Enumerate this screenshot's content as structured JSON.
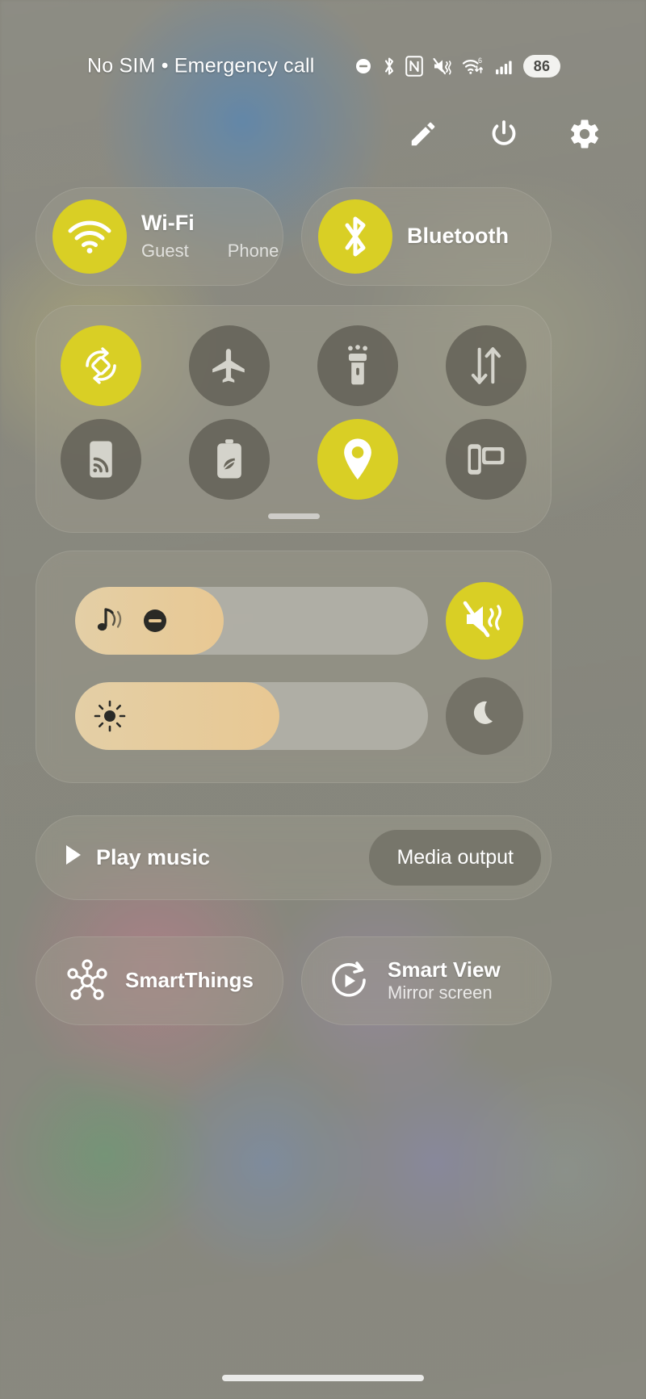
{
  "status_bar": {
    "carrier_text": "No SIM • Emergency call",
    "icons": [
      {
        "name": "do-not-disturb-icon",
        "label": "Do not disturb"
      },
      {
        "name": "bluetooth-icon",
        "label": "Bluetooth"
      },
      {
        "name": "nfc-icon",
        "label": "NFC"
      },
      {
        "name": "sound-vibrate-off-icon",
        "label": "Mute / vibrate"
      },
      {
        "name": "wifi-6-icon",
        "label": "Wi-Fi 6"
      },
      {
        "name": "cellular-signal-icon",
        "label": "Signal"
      }
    ],
    "battery_percent": "86"
  },
  "toolbar": {
    "edit_label": "Edit",
    "power_label": "Power off",
    "settings_label": "Settings"
  },
  "top_tiles": {
    "wifi": {
      "title": "Wi-Fi",
      "subtitle_1": "Guest",
      "subtitle_2": "Phone",
      "state": "on",
      "icon": "wifi-icon"
    },
    "bluetooth": {
      "title": "Bluetooth",
      "state": "on",
      "icon": "bluetooth-icon"
    }
  },
  "toggles": [
    {
      "name": "auto-rotate",
      "label": "Auto rotate",
      "icon": "auto-rotate-icon",
      "state": "on"
    },
    {
      "name": "airplane-mode",
      "label": "Airplane mode",
      "icon": "airplane-icon",
      "state": "off"
    },
    {
      "name": "flashlight",
      "label": "Flashlight",
      "icon": "flashlight-icon",
      "state": "off"
    },
    {
      "name": "mobile-data",
      "label": "Mobile data",
      "icon": "data-arrows-icon",
      "state": "off"
    },
    {
      "name": "nfc",
      "label": "NFC",
      "icon": "nfc-tag-icon",
      "state": "off"
    },
    {
      "name": "power-saving",
      "label": "Power saving",
      "icon": "battery-leaf-icon",
      "state": "off"
    },
    {
      "name": "location",
      "label": "Location",
      "icon": "location-pin-icon",
      "state": "on"
    },
    {
      "name": "smart-view",
      "label": "Smart View",
      "icon": "screen-cast-icon",
      "state": "off"
    }
  ],
  "sliders": {
    "volume": {
      "label": "Volume",
      "value_percent": 42,
      "icons": [
        "music-note-icon",
        "do-not-disturb-icon"
      ],
      "side_button": {
        "name": "mute-button",
        "label": "Mute",
        "icon": "volume-mute-vibrate-icon",
        "state": "on"
      }
    },
    "brightness": {
      "label": "Brightness",
      "value_percent": 58,
      "icons": [
        "brightness-sun-icon"
      ],
      "side_button": {
        "name": "dark-mode-button",
        "label": "Dark mode",
        "icon": "moon-icon",
        "state": "off"
      }
    }
  },
  "media": {
    "play_label": "Play music",
    "play_icon": "play-icon",
    "output_label": "Media output"
  },
  "bottom_tiles": {
    "smartthings": {
      "title": "SmartThings",
      "icon": "smartthings-hub-icon"
    },
    "smartview": {
      "title": "Smart View",
      "subtitle": "Mirror screen",
      "icon": "smart-view-cast-icon"
    }
  },
  "colors": {
    "accent_on": "#d9cf25",
    "toggle_off": "#60584c",
    "slider_fill": "#e8c893",
    "panel": "#a09e90",
    "text": "#ffffff"
  }
}
